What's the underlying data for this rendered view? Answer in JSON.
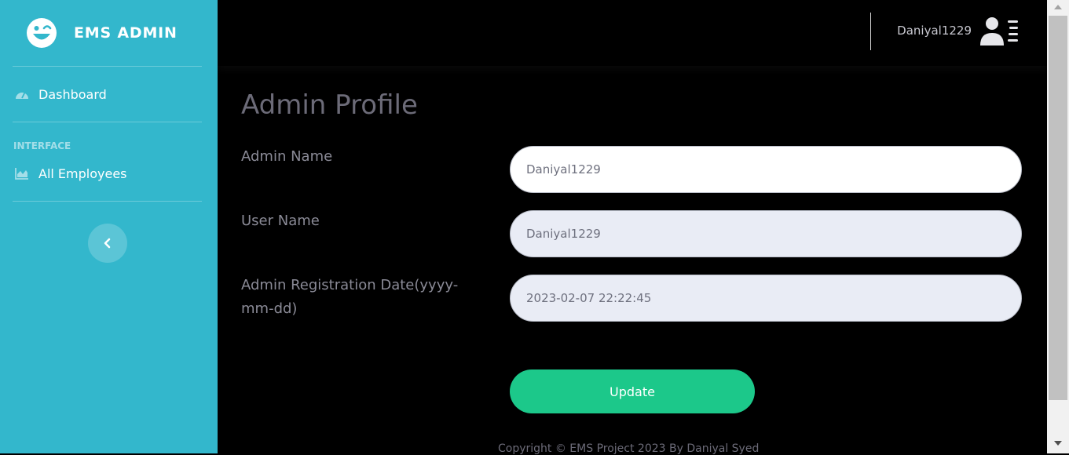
{
  "brand": {
    "title": "EMS ADMIN",
    "icon": "laugh-wink-icon"
  },
  "sidebar": {
    "items": [
      {
        "label": "Dashboard",
        "icon": "tachometer-icon"
      },
      {
        "label": "All Employees",
        "icon": "chart-area-icon"
      }
    ],
    "heading": "INTERFACE",
    "toggle_icon": "chevron-left-icon"
  },
  "topbar": {
    "username": "Daniyal1229",
    "avatar_icon": "user-list-icon"
  },
  "main": {
    "title": "Admin Profile",
    "fields": {
      "admin_name": {
        "label": "Admin Name",
        "value": "Daniyal1229"
      },
      "user_name": {
        "label": "User Name",
        "value": "Daniyal1229"
      },
      "reg_date": {
        "label": "Admin Registration Date(yyyy-mm-dd)",
        "value": "2023-02-07 22:22:45"
      }
    },
    "update_label": "Update",
    "footer": "Copyright © EMS Project 2023 By Daniyal Syed"
  },
  "colors": {
    "sidebar": "#33b7cc",
    "background": "#000000",
    "accent_button": "#1cc88a"
  }
}
